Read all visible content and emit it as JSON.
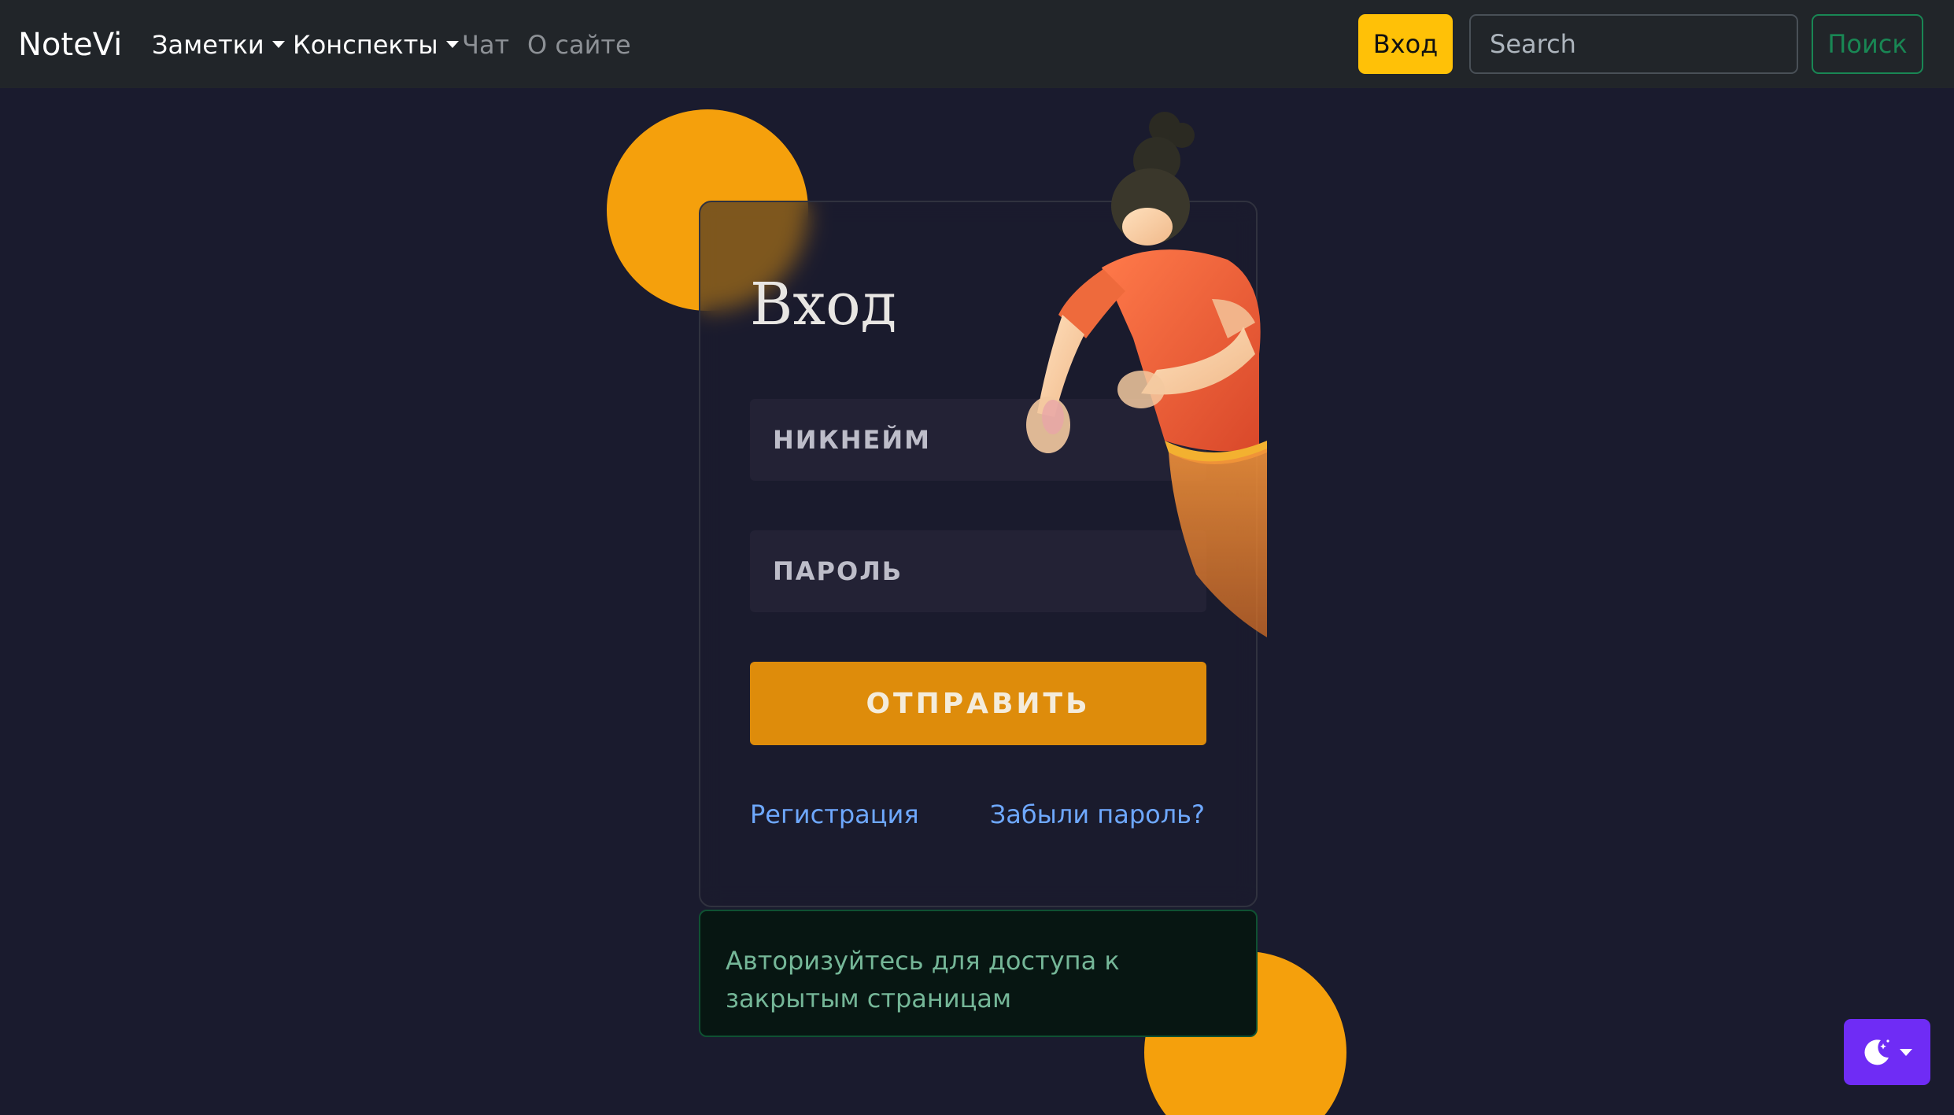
{
  "navbar": {
    "brand": "NoteVi",
    "items": [
      {
        "label": "Заметки",
        "dropdown": true
      },
      {
        "label": "Конспекты",
        "dropdown": true
      },
      {
        "label": "Чат",
        "dropdown": false
      },
      {
        "label": "О сайте",
        "dropdown": false
      }
    ],
    "login_label": "Вход",
    "search_placeholder": "Search",
    "search_button": "Поиск"
  },
  "login_form": {
    "title": "Вход",
    "nickname_placeholder": "НИКНЕЙМ",
    "password_placeholder": "ПАРОЛЬ",
    "submit_label": "ОТПРАВИТЬ",
    "register_link": "Регистрация",
    "forgot_link": "Забыли пароль?"
  },
  "alert": {
    "message": "Авторизуйтесь для доступа к закрытым страницам"
  },
  "theme_toggle": {
    "icon": "moon-stars-icon"
  },
  "colors": {
    "accent": "#f5a00c",
    "submit": "#de8c0b",
    "nav_login": "#ffc107",
    "search_button": "#198754",
    "theme_toggle": "#6f2cf5",
    "background": "#1a1b2e"
  }
}
